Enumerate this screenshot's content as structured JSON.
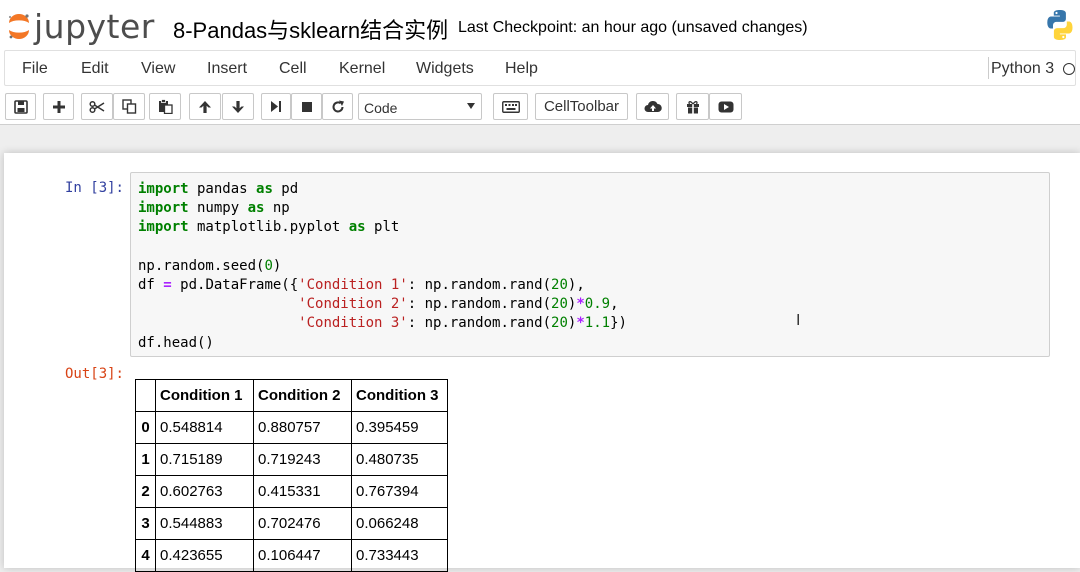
{
  "header": {
    "logo_text": "jupyter",
    "notebook_title": "8-Pandas与sklearn结合实例",
    "checkpoint": "Last Checkpoint: an hour ago (unsaved changes)"
  },
  "menu": {
    "items": [
      "File",
      "Edit",
      "View",
      "Insert",
      "Cell",
      "Kernel",
      "Widgets",
      "Help"
    ],
    "kernel_name": "Python 3"
  },
  "toolbar": {
    "cell_type": "Code",
    "celltoolbar_label": "CellToolbar",
    "icons": [
      "save-icon",
      "plus-icon",
      "cut-icon",
      "copy-icon",
      "paste-icon",
      "arrow-up-icon",
      "arrow-down-icon",
      "run-icon",
      "stop-icon",
      "restart-icon",
      "keyboard-icon",
      "cloud-upload-icon",
      "gift-icon",
      "youtube-icon"
    ]
  },
  "cell": {
    "in_prompt": "In [3]:",
    "out_prompt": "Out[3]:",
    "code_lines": [
      "import pandas as pd",
      "import numpy as np",
      "import matplotlib.pyplot as plt",
      "",
      "np.random.seed(0)",
      "df = pd.DataFrame({'Condition 1': np.random.rand(20),",
      "                   'Condition 2': np.random.rand(20)*0.9,",
      "                   'Condition 3': np.random.rand(20)*1.1})",
      "df.head()"
    ]
  },
  "output_table": {
    "columns": [
      "",
      "Condition 1",
      "Condition 2",
      "Condition 3"
    ],
    "rows": [
      [
        "0",
        "0.548814",
        "0.880757",
        "0.395459"
      ],
      [
        "1",
        "0.715189",
        "0.719243",
        "0.480735"
      ],
      [
        "2",
        "0.602763",
        "0.415331",
        "0.767394"
      ],
      [
        "3",
        "0.544883",
        "0.702476",
        "0.066248"
      ],
      [
        "4",
        "0.423655",
        "0.106447",
        "0.733443"
      ]
    ]
  },
  "colors": {
    "in_prompt": "#303f9f",
    "out_prompt": "#d84315",
    "keyword": "#008000",
    "string": "#ba2121",
    "operator": "#aa22ff"
  }
}
